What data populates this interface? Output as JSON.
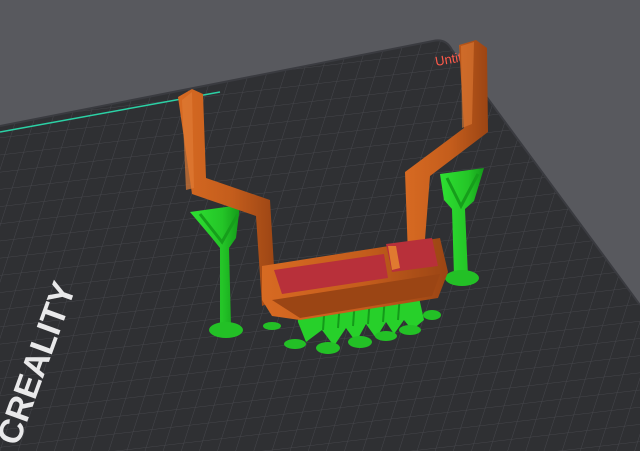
{
  "viewer": {
    "bed_name_label": "Untitled",
    "bed_brand_label": "CREALITY"
  },
  "colors": {
    "background": "#58595e",
    "bed_surface": "#2f3033",
    "bed_grid": "#4b4c52",
    "bed_edge_highlight": "#2bd1a5",
    "model_body": "#c8621e",
    "model_shadow": "#8e3f12",
    "model_top_surface": "#b8303a",
    "support": "#27d02a",
    "support_shadow": "#149a1a",
    "bed_label_text": "#ff5a4a",
    "brand_text": "#e9e9ea"
  },
  "icons": {
    "model": "printed-part-model",
    "supports": "tree-support-structures"
  }
}
